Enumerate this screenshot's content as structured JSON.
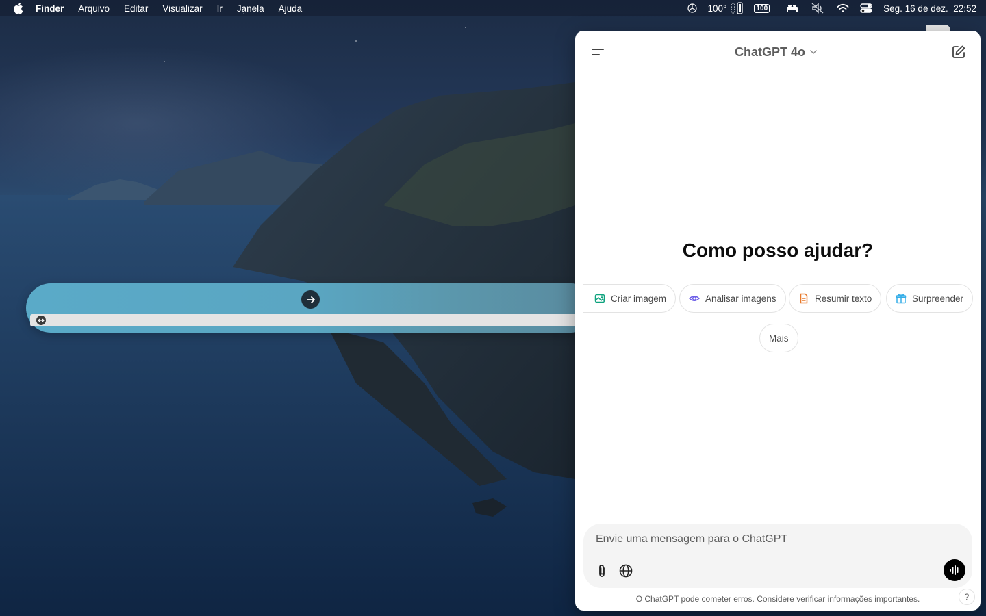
{
  "menubar": {
    "app_name": "Finder",
    "items": [
      "Arquivo",
      "Editar",
      "Visualizar",
      "Ir",
      "Janela",
      "Ajuda"
    ],
    "temperature": "100°",
    "battery_badge": "100",
    "datetime": "Seg. 16 de dez.  22:52",
    "icons": [
      "apple-icon",
      "chatgpt-icon",
      "battery-icon",
      "battery-badge-icon",
      "bed-icon",
      "mute-icon",
      "wifi-icon",
      "control-center-icon"
    ]
  },
  "pill_widget": {
    "icons": [
      "arrow-right-icon",
      "resize-icon",
      "chevron-down-icon"
    ]
  },
  "chat": {
    "model_name": "ChatGPT 4o",
    "headline": "Como posso ajudar?",
    "suggestions": [
      {
        "label": "Criar imagem",
        "icon": "image-icon",
        "color": "#10a37f"
      },
      {
        "label": "Analisar imagens",
        "icon": "eye-icon",
        "color": "#6b5ce7"
      },
      {
        "label": "Resumir texto",
        "icon": "document-icon",
        "color": "#e8792a"
      },
      {
        "label": "Surpreender",
        "icon": "gift-icon",
        "color": "#35aee8"
      }
    ],
    "more_label": "Mais",
    "composer_placeholder": "Envie uma mensagem para o ChatGPT",
    "disclaimer": "O ChatGPT pode cometer erros. Considere verificar informações importantes.",
    "help_label": "?"
  }
}
